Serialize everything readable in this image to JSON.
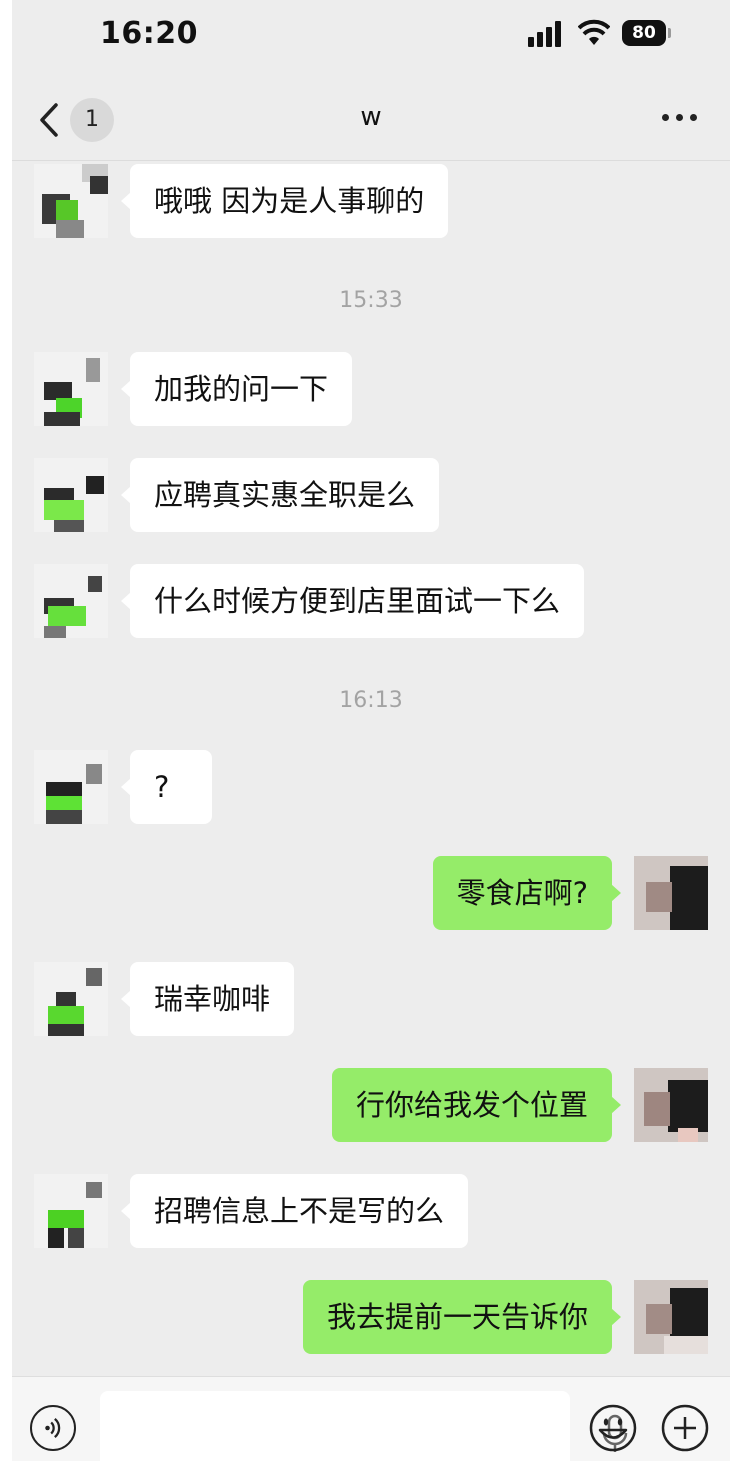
{
  "status_bar": {
    "time": "16:20",
    "battery": "80"
  },
  "nav": {
    "back_count": "1",
    "title": "w"
  },
  "messages": [
    {
      "text": "哦哦   因为是人事聊的"
    },
    {
      "timestamp": "15:33"
    },
    {
      "text": "加我的问一下"
    },
    {
      "text": "应聘真实惠全职是么"
    },
    {
      "text": "什么时候方便到店里面试一下么"
    },
    {
      "timestamp": "16:13"
    },
    {
      "text": "?"
    },
    {
      "text": "零食店啊?"
    },
    {
      "text": "瑞幸咖啡"
    },
    {
      "text": "行你给我发个位置"
    },
    {
      "text": "招聘信息上不是写的么"
    },
    {
      "text": "我去提前一天告诉你"
    }
  ],
  "icons": {
    "back": "chevron-left-icon",
    "more": "more-dots-icon",
    "voice": "voice-icon",
    "mic": "mic-icon",
    "emoji": "emoji-icon",
    "plus": "plus-icon"
  },
  "colors": {
    "background": "#ededed",
    "incoming_bubble": "#ffffff",
    "outgoing_bubble": "#95ec69",
    "timestamp": "#a3a3a3"
  }
}
